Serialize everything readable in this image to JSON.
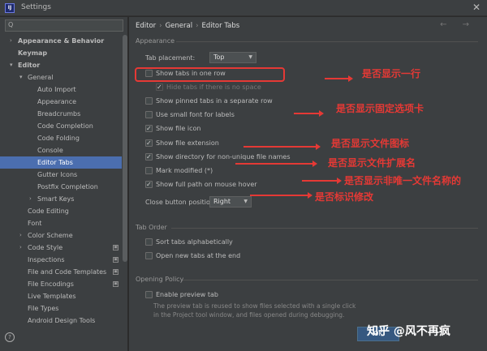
{
  "window": {
    "title": "Settings",
    "app_icon": "IJ"
  },
  "sidebar": {
    "search_placeholder": "Q",
    "items": [
      {
        "label": "Appearance & Behavior",
        "level": 0,
        "arrow": ">"
      },
      {
        "label": "Keymap",
        "level": 0
      },
      {
        "label": "Editor",
        "level": 0,
        "arrow": "v"
      },
      {
        "label": "General",
        "level": 1,
        "arrow": "v"
      },
      {
        "label": "Auto Import",
        "level": 2
      },
      {
        "label": "Appearance",
        "level": 2
      },
      {
        "label": "Breadcrumbs",
        "level": 2
      },
      {
        "label": "Code Completion",
        "level": 2
      },
      {
        "label": "Code Folding",
        "level": 2
      },
      {
        "label": "Console",
        "level": 2
      },
      {
        "label": "Editor Tabs",
        "level": 2,
        "selected": true
      },
      {
        "label": "Gutter Icons",
        "level": 2
      },
      {
        "label": "Postfix Completion",
        "level": 2
      },
      {
        "label": "Smart Keys",
        "level": 2,
        "arrow": ">"
      },
      {
        "label": "Code Editing",
        "level": 1
      },
      {
        "label": "Font",
        "level": 1
      },
      {
        "label": "Color Scheme",
        "level": 1,
        "arrow": ">"
      },
      {
        "label": "Code Style",
        "level": 1,
        "arrow": ">",
        "badge": true
      },
      {
        "label": "Inspections",
        "level": 1,
        "badge": true
      },
      {
        "label": "File and Code Templates",
        "level": 1,
        "badge": true
      },
      {
        "label": "File Encodings",
        "level": 1,
        "badge": true
      },
      {
        "label": "Live Templates",
        "level": 1
      },
      {
        "label": "File Types",
        "level": 1
      },
      {
        "label": "Android Design Tools",
        "level": 1
      }
    ],
    "help": "?"
  },
  "breadcrumb": [
    "Editor",
    "General",
    "Editor Tabs"
  ],
  "nav_arrows": "← →",
  "appearance": {
    "title": "Appearance",
    "tab_placement_label": "Tab placement:",
    "tab_placement_value": "Top",
    "options": [
      {
        "label": "Show tabs in one row",
        "checked": false
      },
      {
        "label": "Hide tabs if there is no space",
        "checked": true,
        "disabled": true
      },
      {
        "label": "Show pinned tabs in a separate row",
        "checked": false
      },
      {
        "label": "Use small font for labels",
        "checked": false
      },
      {
        "label": "Show file icon",
        "checked": true
      },
      {
        "label": "Show file extension",
        "checked": true
      },
      {
        "label": "Show directory for non-unique file names",
        "checked": true
      },
      {
        "label": "Mark modified (*)",
        "checked": false
      },
      {
        "label": "Show full path on mouse hover",
        "checked": true
      }
    ],
    "close_button_label": "Close button position:",
    "close_button_value": "Right"
  },
  "tab_order": {
    "title": "Tab Order",
    "options": [
      {
        "label": "Sort tabs alphabetically",
        "checked": false
      },
      {
        "label": "Open new tabs at the end",
        "checked": false
      }
    ]
  },
  "opening_policy": {
    "title": "Opening Policy",
    "enable_preview_label": "Enable preview tab",
    "description_line1": "The preview tab is reused to show files selected with a single click",
    "description_line2": "in the Project tool window, and files opened during debugging."
  },
  "annotations": [
    "是否显示一行",
    "是否显示固定选项卡",
    "是否显示文件图标",
    "是否显示文件扩展名",
    "是否显示非唯一文件名称的",
    "是否标识修改"
  ],
  "annotation_color": "#e53935",
  "accent_color": "#4b6eaf",
  "buttons": {
    "ok": "OK"
  },
  "watermark": "知乎 @风不再疯"
}
